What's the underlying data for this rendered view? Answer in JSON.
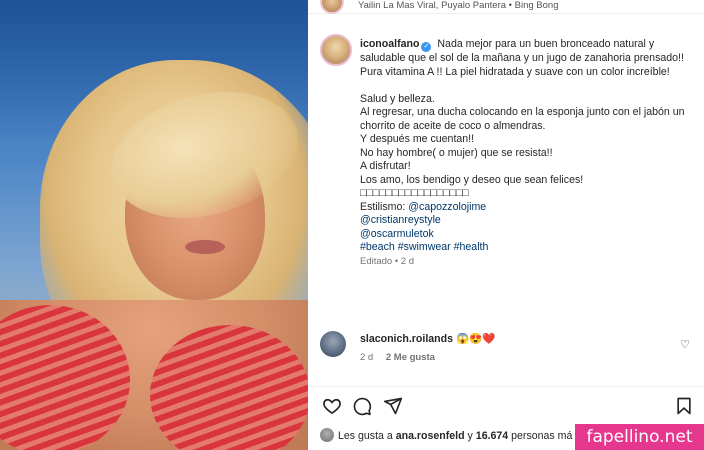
{
  "post": {
    "audio_line": "Yailin La Mas Viral, Puyalo Pantera • Bing Bong",
    "username": "iconoalfano",
    "caption_lines": [
      "Nada mejor para un buen bronceado natural y saludable que el sol de la mañana y un jugo de zanahoria prensado!!",
      "Pura vitamina A !! La piel hidratada y suave con un color increíble!"
    ],
    "caption_lines_2": [
      "Salud y belleza.",
      "Al regresar, una ducha colocando en la esponja junto con el jabón un chorrito de aceite de coco o almendras.",
      "Y después me cuentan!!",
      "No hay hombre( o mujer) que se resista!!",
      "A disfrutar!",
      "Los amo, los bendigo y deseo que sean felices!",
      "□□□□□□□□□□□□□□□□□"
    ],
    "styling_prefix": "Estilismo: ",
    "mention_1": "@capozzolojime",
    "mention_2": "@cristianreystyle",
    "mention_3": "@oscarmuletok",
    "hashtags": "#beach #swimwear #health",
    "edited_meta": "Editado • 2 d"
  },
  "comment": {
    "username": "slaconich.roilands",
    "emojis": "😱😍❤️",
    "time": "2 d",
    "likes": "2 Me gusta"
  },
  "likes": {
    "prefix": "Les gusta a ",
    "user": "ana.rosenfeld",
    "middle": " y ",
    "count": "16.674",
    "suffix": " personas má"
  },
  "watermark": "fapellino.net",
  "colors": {
    "link": "#00376b",
    "verified": "#3897f0",
    "watermark_bg": "#e6378f"
  },
  "icons": [
    "heart-icon",
    "comment-icon",
    "share-icon",
    "bookmark-icon",
    "verified-icon"
  ]
}
